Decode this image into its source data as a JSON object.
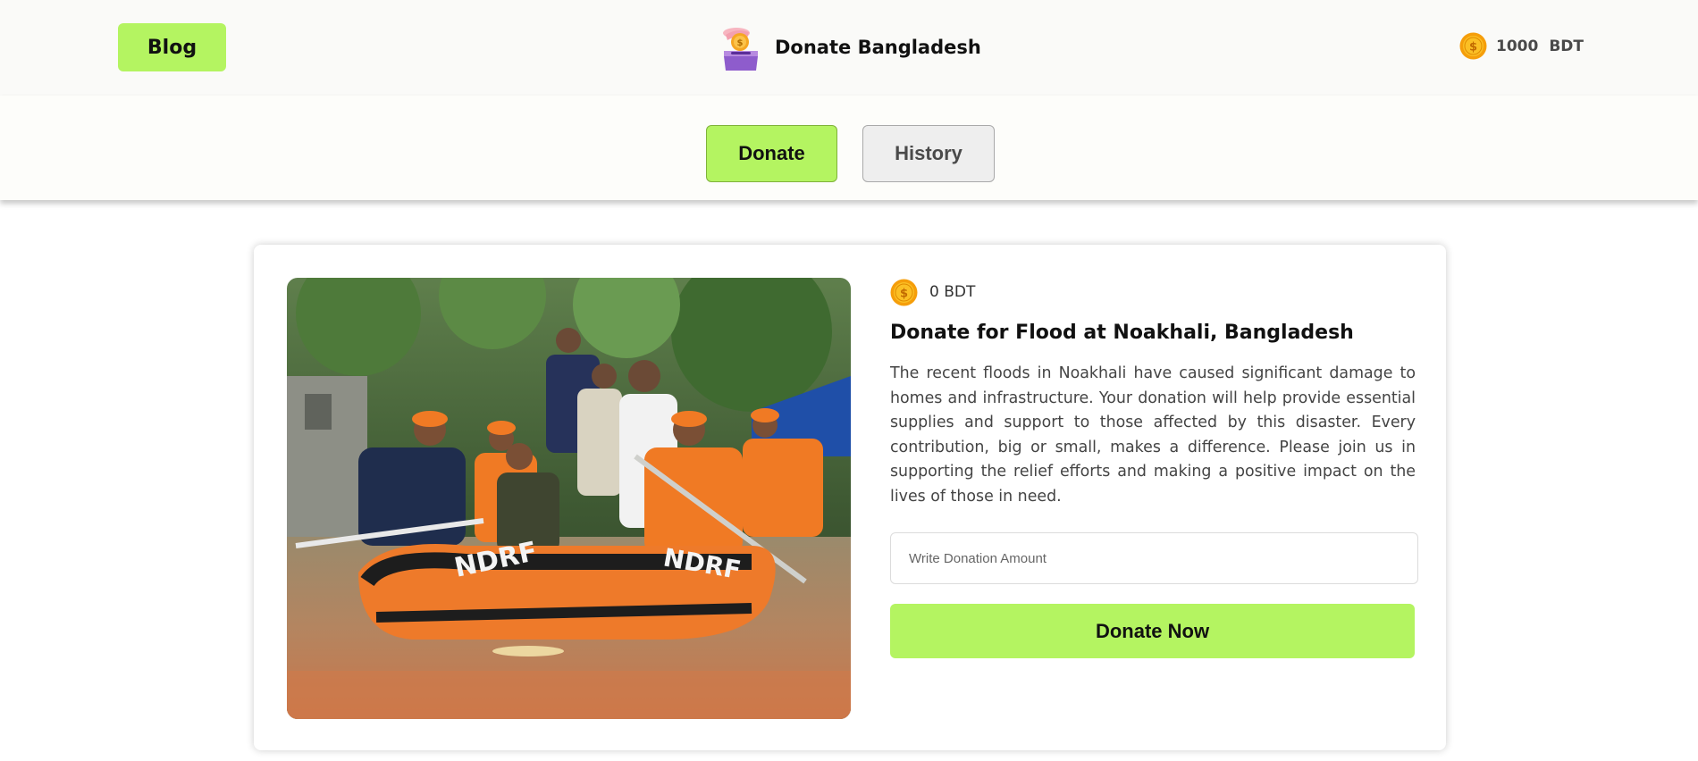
{
  "header": {
    "blog_label": "Blog",
    "brand_title": "Donate Bangladesh",
    "brand_logo_icon": "donation-box-icon",
    "balance_icon": "gold-coin-icon",
    "balance_amount": "1000",
    "balance_currency": "BDT"
  },
  "tabs": [
    {
      "label": "Donate",
      "active": true
    },
    {
      "label": "History",
      "active": false
    }
  ],
  "card": {
    "image_alt": "flood-rescue-photo",
    "raised_icon": "gold-coin-icon",
    "raised_amount": "0 BDT",
    "title": "Donate for Flood at Noakhali, Bangladesh",
    "description": "The recent floods in Noakhali have caused significant damage to homes and infrastructure. Your donation will help provide essential supplies and support to those affected by this disaster. Every contribution, big or small, makes a difference. Please join us in supporting the relief efforts and making a positive impact on the lives of those in need.",
    "input_placeholder": "Write Donation Amount",
    "input_value": "",
    "donate_button_label": "Donate Now"
  },
  "colors": {
    "accent": "#b4f461",
    "header_bg": "#fafaf8",
    "coin": "#f5a623"
  }
}
